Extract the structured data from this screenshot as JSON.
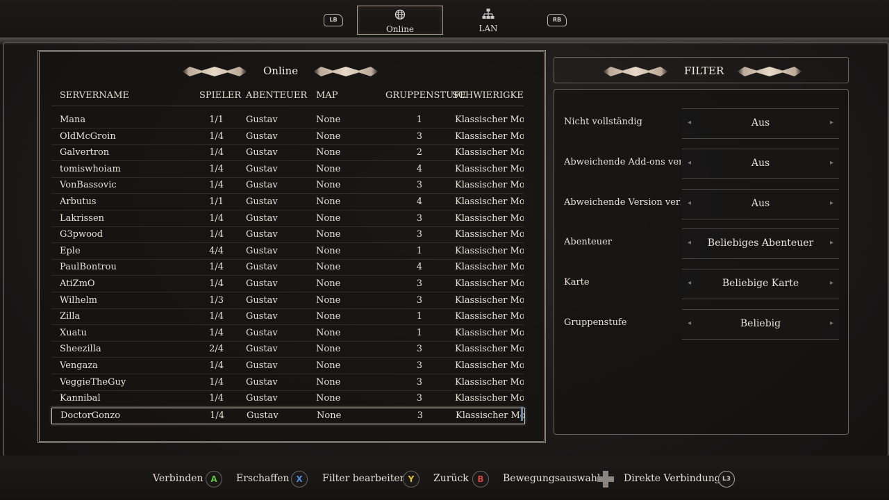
{
  "tabs": {
    "lb": "LB",
    "rb": "RB",
    "online": "Online",
    "lan": "LAN"
  },
  "left_panel": {
    "title": "Online",
    "columns": [
      "SERVERNAME",
      "SPIELER",
      "ABENTEUER",
      "MAP",
      "GRUPPENSTUFE",
      "SCHWIERIGKEIT"
    ],
    "rows": [
      {
        "name": "Mana",
        "spieler": "1/1",
        "abenteuer": "Gustav",
        "map": "None",
        "stufe": "1",
        "schwierigkeit": "Klassischer Modus"
      },
      {
        "name": "OldMcGroin",
        "spieler": "1/4",
        "abenteuer": "Gustav",
        "map": "None",
        "stufe": "3",
        "schwierigkeit": "Klassischer Modus"
      },
      {
        "name": "Galvertron",
        "spieler": "1/4",
        "abenteuer": "Gustav",
        "map": "None",
        "stufe": "2",
        "schwierigkeit": "Klassischer Modus"
      },
      {
        "name": "tomiswhoiam",
        "spieler": "1/4",
        "abenteuer": "Gustav",
        "map": "None",
        "stufe": "4",
        "schwierigkeit": "Klassischer Modus"
      },
      {
        "name": "VonBassovic",
        "spieler": "1/4",
        "abenteuer": "Gustav",
        "map": "None",
        "stufe": "3",
        "schwierigkeit": "Klassischer Modus"
      },
      {
        "name": "Arbutus",
        "spieler": "1/1",
        "abenteuer": "Gustav",
        "map": "None",
        "stufe": "4",
        "schwierigkeit": "Klassischer Modus"
      },
      {
        "name": "Lakrissen",
        "spieler": "1/4",
        "abenteuer": "Gustav",
        "map": "None",
        "stufe": "3",
        "schwierigkeit": "Klassischer Modus"
      },
      {
        "name": "G3pwood",
        "spieler": "1/4",
        "abenteuer": "Gustav",
        "map": "None",
        "stufe": "3",
        "schwierigkeit": "Klassischer Modus"
      },
      {
        "name": "Eple",
        "spieler": "4/4",
        "abenteuer": "Gustav",
        "map": "None",
        "stufe": "1",
        "schwierigkeit": "Klassischer Modus"
      },
      {
        "name": "PaulBontrou",
        "spieler": "1/4",
        "abenteuer": "Gustav",
        "map": "None",
        "stufe": "4",
        "schwierigkeit": "Klassischer Modus"
      },
      {
        "name": "AtiZmO",
        "spieler": "1/4",
        "abenteuer": "Gustav",
        "map": "None",
        "stufe": "3",
        "schwierigkeit": "Klassischer Modus"
      },
      {
        "name": "Wilhelm",
        "spieler": "1/3",
        "abenteuer": "Gustav",
        "map": "None",
        "stufe": "3",
        "schwierigkeit": "Klassischer Modus"
      },
      {
        "name": "Zilla",
        "spieler": "1/4",
        "abenteuer": "Gustav",
        "map": "None",
        "stufe": "1",
        "schwierigkeit": "Klassischer Modus"
      },
      {
        "name": "Xuatu",
        "spieler": "1/4",
        "abenteuer": "Gustav",
        "map": "None",
        "stufe": "1",
        "schwierigkeit": "Klassischer Modus"
      },
      {
        "name": "Sheezilla",
        "spieler": "2/4",
        "abenteuer": "Gustav",
        "map": "None",
        "stufe": "3",
        "schwierigkeit": "Klassischer Modus"
      },
      {
        "name": "Vengaza",
        "spieler": "1/4",
        "abenteuer": "Gustav",
        "map": "None",
        "stufe": "3",
        "schwierigkeit": "Klassischer Modus"
      },
      {
        "name": "VeggieTheGuy",
        "spieler": "1/4",
        "abenteuer": "Gustav",
        "map": "None",
        "stufe": "3",
        "schwierigkeit": "Klassischer Modus"
      },
      {
        "name": "Kannibal",
        "spieler": "1/4",
        "abenteuer": "Gustav",
        "map": "None",
        "stufe": "3",
        "schwierigkeit": "Klassischer Modus"
      },
      {
        "name": "DoctorGonzo",
        "spieler": "1/4",
        "abenteuer": "Gustav",
        "map": "None",
        "stufe": "3",
        "schwierigkeit": "Klassischer Modus"
      }
    ],
    "selected_index": 18
  },
  "filter_panel": {
    "title": "FILTER",
    "rows": [
      {
        "label": "Nicht vollständig",
        "value": "Aus"
      },
      {
        "label": "Abweichende Add-ons verbergen",
        "value": "Aus"
      },
      {
        "label": "Abweichende Version verbergen",
        "value": "Aus"
      },
      {
        "label": "Abenteuer",
        "value": "Beliebiges Abenteuer"
      },
      {
        "label": "Karte",
        "value": "Beliebige Karte"
      },
      {
        "label": "Gruppenstufe",
        "value": "Beliebig"
      }
    ]
  },
  "bottom_hints": {
    "verbinden": "Verbinden",
    "erschaffen": "Erschaffen",
    "filter": "Filter bearbeiten",
    "zurueck": "Zurück",
    "bewegung": "Bewegungsauswahl",
    "direkt": "Direkte Verbindung",
    "btn_a": "A",
    "btn_x": "X",
    "btn_y": "Y",
    "btn_b": "B",
    "btn_l3": "L3"
  },
  "colors": {
    "button_a": "#5fbf49",
    "button_x": "#4d8fd6",
    "button_y": "#e6c23a",
    "button_b": "#d44242",
    "scroll_thumb": "#6d8cab"
  }
}
